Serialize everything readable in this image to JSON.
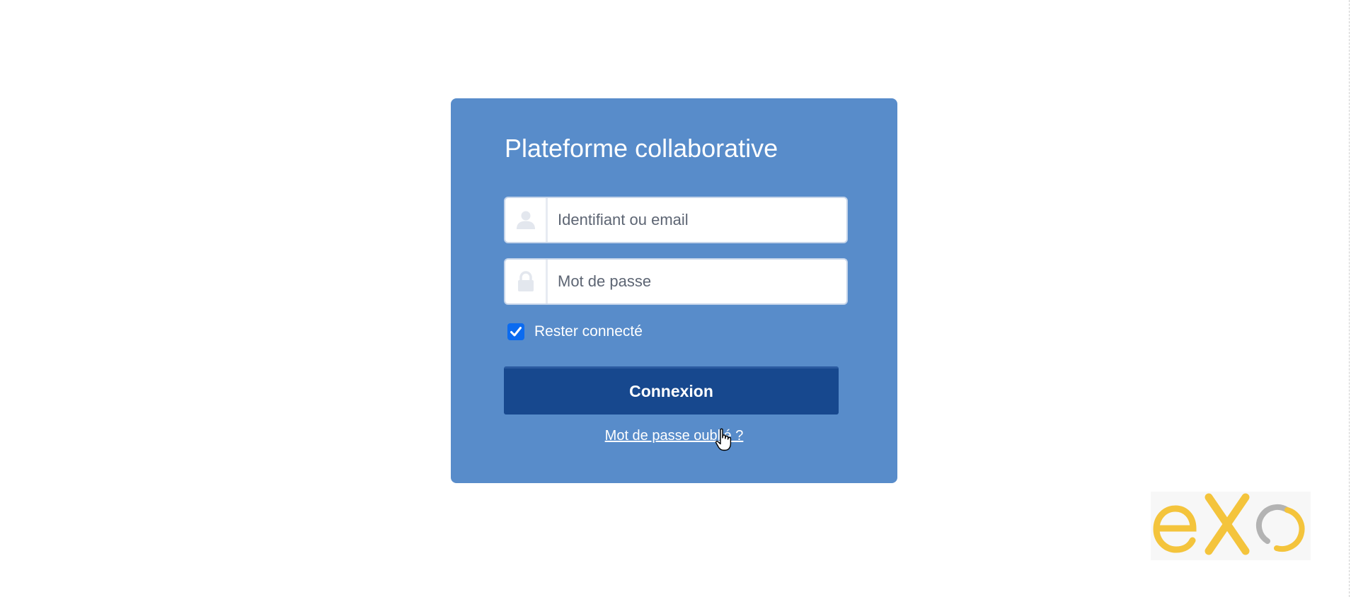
{
  "login": {
    "title": "Plateforme collaborative",
    "username_placeholder": "Identifiant ou email",
    "password_placeholder": "Mot de passe",
    "remember_label": "Rester connecté",
    "remember_checked": true,
    "submit_label": "Connexion",
    "forgot_link": "Mot de passe oublié ?"
  },
  "icons": {
    "username": "user-icon",
    "password": "lock-icon",
    "checkbox": "checkmark-icon",
    "cursor": "hand-pointer-icon"
  },
  "logo": {
    "text": "eXo"
  },
  "colors": {
    "card_background": "#588cca",
    "button_background": "#17488e",
    "checkbox": "#0b6bf0",
    "logo_yellow": "#f4c43c",
    "logo_grey": "#b3b3b3"
  }
}
